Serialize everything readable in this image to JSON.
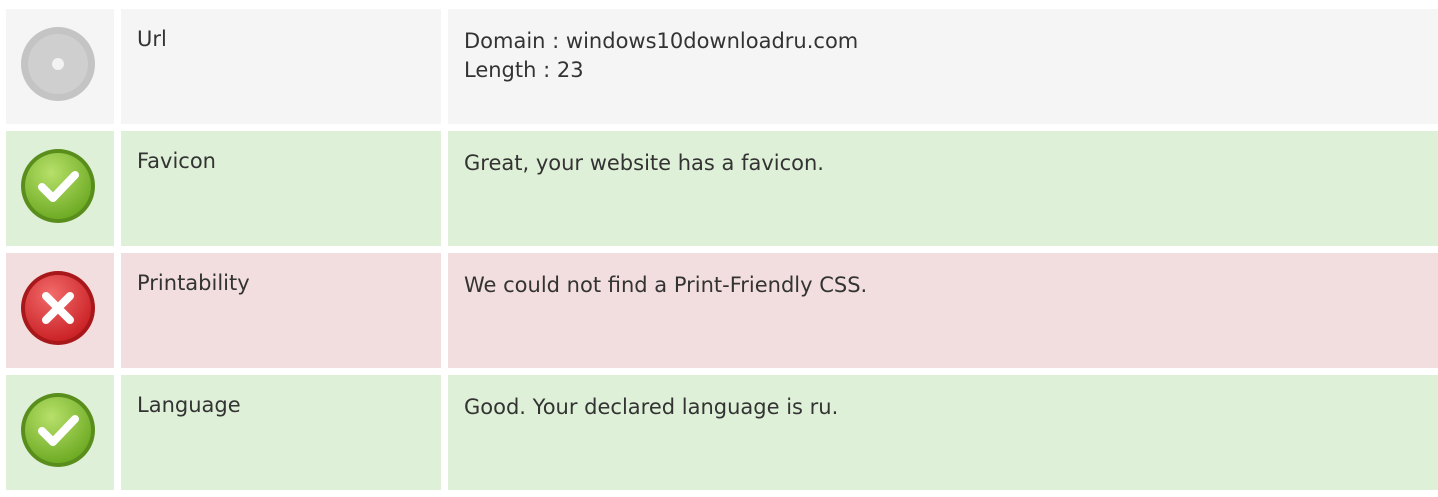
{
  "rows": [
    {
      "status": "neutral",
      "icon": "neutral-disc-icon",
      "label": "Url",
      "lines": [
        "Domain : windows10downloadru.com",
        "Length : 23"
      ]
    },
    {
      "status": "good",
      "icon": "check-icon",
      "label": "Favicon",
      "lines": [
        "Great, your website has a favicon."
      ]
    },
    {
      "status": "bad",
      "icon": "cross-icon",
      "label": "Printability",
      "lines": [
        "We could not find a Print-Friendly CSS."
      ]
    },
    {
      "status": "good",
      "icon": "check-icon",
      "label": "Language",
      "lines": [
        "Good. Your declared language is ru."
      ]
    }
  ],
  "colors": {
    "good_bg": "#dff0d8",
    "bad_bg": "#f2dede",
    "neutral_bg": "#f5f5f5",
    "check_green": "#8cc63f",
    "cross_red": "#e2393c",
    "disc_gray": "#c8c8c8"
  }
}
